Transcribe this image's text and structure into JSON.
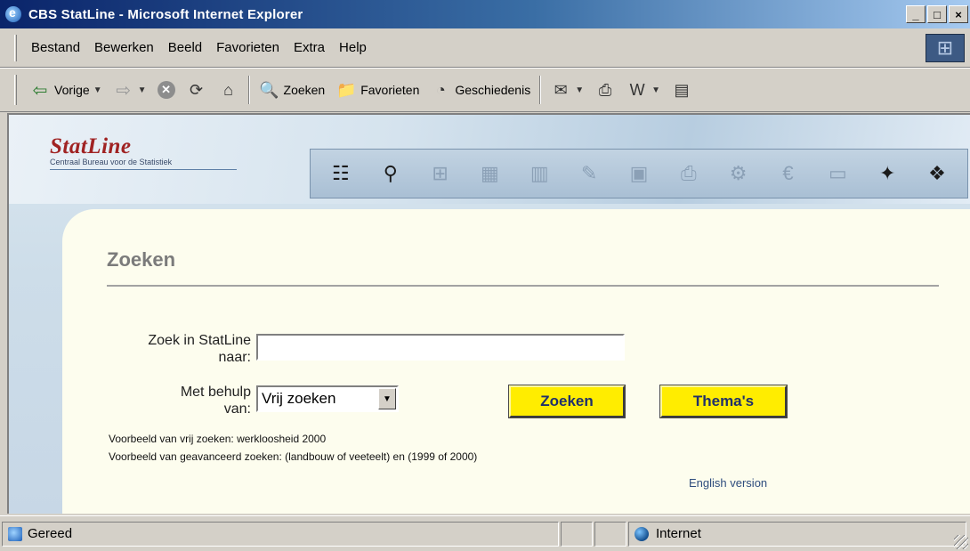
{
  "window": {
    "title": "CBS StatLine - Microsoft Internet Explorer",
    "minimize": "_",
    "maximize": "□",
    "close": "×"
  },
  "menu": {
    "items": [
      {
        "label": "Bestand"
      },
      {
        "label": "Bewerken"
      },
      {
        "label": "Beeld"
      },
      {
        "label": "Favorieten"
      },
      {
        "label": "Extra"
      },
      {
        "label": "Help"
      }
    ]
  },
  "toolbar": {
    "back_label": "Vorige",
    "search_label": "Zoeken",
    "favorites_label": "Favorieten",
    "history_label": "Geschiedenis"
  },
  "site": {
    "brand": "StatLine",
    "subtitle": "Centraal Bureau voor de Statistiek"
  },
  "page": {
    "title": "Zoeken",
    "search_label_line1": "Zoek in StatLine",
    "search_label_line2": "naar:",
    "search_value": "",
    "method_label_line1": "Met behulp",
    "method_label_line2": "van:",
    "method_selected": "Vrij zoeken",
    "search_button": "Zoeken",
    "themes_button": "Thema's",
    "example_free": "Voorbeeld van vrij zoeken: werkloosheid 2000",
    "example_advanced": "Voorbeeld van geavanceerd zoeken: (landbouw of veeteelt) en (1999 of 2000)",
    "english_link": "English version"
  },
  "status": {
    "text": "Gereed",
    "zone": "Internet"
  },
  "colors": {
    "title_bar": "#0a246a",
    "button_yellow": "#ffed00",
    "brand_red": "#a02323",
    "panel_bg": "#fdfdee"
  }
}
